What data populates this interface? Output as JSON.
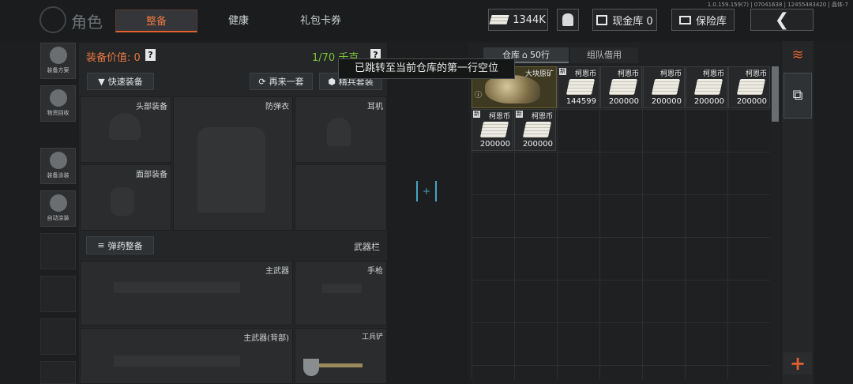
{
  "build_info": "1.0.159.159(7) | 07041638 | 12455483420 | 晶体-7",
  "header": {
    "title": "角色",
    "tabs": [
      {
        "label": "整备",
        "active": true
      },
      {
        "label": "健康",
        "active": false
      },
      {
        "label": "礼包卡券",
        "active": false
      }
    ],
    "currency": "1344K",
    "cash_vault": "现金库 0",
    "safe": "保险库",
    "back_icon": "chevron-left-icon"
  },
  "sidebar": [
    {
      "label": "装备方案",
      "icon": "gear-loadout-icon"
    },
    {
      "label": "物资回收",
      "icon": "recycle-icon"
    },
    {
      "label": "装备涂装",
      "icon": "spray-icon"
    },
    {
      "label": "自动涂装",
      "icon": "auto-spray-icon"
    }
  ],
  "equipment": {
    "value_label": "装备价值: 0",
    "weight": "1/70 千克",
    "quick_equip": "快速装备",
    "redo": "再来一套",
    "elite": "精兵套装",
    "slots": {
      "head": "头部装备",
      "armor": "防弹衣",
      "headset": "耳机",
      "face": "面部装备"
    },
    "ammo_button": "弹药整备",
    "weapons_section": "武器栏",
    "weapon_slots": {
      "primary": "主武器",
      "pistol": "手枪",
      "primary_back": "主武器(背部)",
      "shovel": "工兵铲"
    }
  },
  "warehouse": {
    "tabs": [
      {
        "label": "仓库",
        "badge": "50行",
        "active": true
      },
      {
        "label": "组队借用",
        "active": false
      }
    ],
    "tooltip": "已跳转至当前仓库的第一行空位",
    "new_badge": "新",
    "items": [
      {
        "name": "大块原矿",
        "qty": ""
      },
      {
        "name": "柯恩币",
        "qty": "144599"
      },
      {
        "name": "柯恩币",
        "qty": "200000"
      },
      {
        "name": "柯恩币",
        "qty": "200000"
      },
      {
        "name": "柯恩币",
        "qty": "200000"
      },
      {
        "name": "柯恩币",
        "qty": "200000"
      },
      {
        "name": "柯恩币",
        "qty": "200000"
      },
      {
        "name": "柯恩币",
        "qty": "200000"
      }
    ]
  },
  "colors": {
    "accent": "#e2612e",
    "weight_green": "#7ec23a",
    "value_orange": "#e9773f"
  }
}
